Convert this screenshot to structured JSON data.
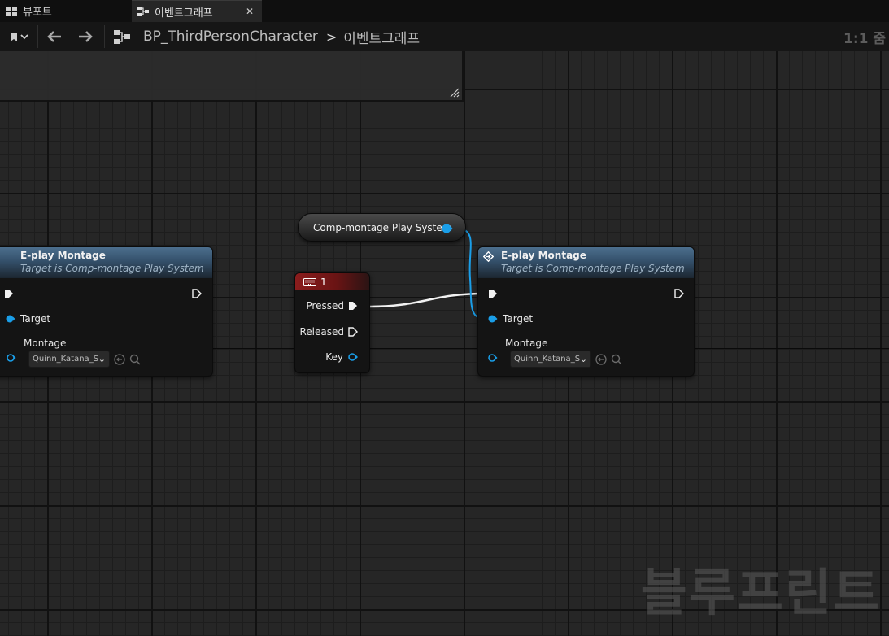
{
  "tabs": [
    {
      "label": "뷰포트",
      "icon": "viewport-grid-icon"
    },
    {
      "label": "이벤트그래프",
      "icon": "graph-nodes-icon",
      "active": true
    }
  ],
  "toolbar": {
    "breadcrumb_root": "BP_ThirdPersonCharacter",
    "breadcrumb_leaf": "이벤트그래프",
    "zoom": "1:1 줌"
  },
  "nodes": {
    "left_play": {
      "title": "E-play Montage",
      "subtitle": "Target is Comp-montage Play System",
      "target_label": "Target",
      "montage_label": "Montage",
      "montage_value": "Quinn_Katana_S"
    },
    "var_node": {
      "label": "Comp-montage Play System"
    },
    "key_node": {
      "key": "1",
      "pressed": "Pressed",
      "released": "Released",
      "key_pin": "Key"
    },
    "right_play": {
      "title": "E-play Montage",
      "subtitle": "Target is Comp-montage Play System",
      "target_label": "Target",
      "montage_label": "Montage",
      "montage_value": "Quinn_Katana_S"
    }
  },
  "colors": {
    "exec": "#ffffff",
    "object_pin": "#1a9ee8",
    "header_function": "#4c6f8e",
    "header_event": "#8a1c1c"
  },
  "watermark": "블루프린트"
}
